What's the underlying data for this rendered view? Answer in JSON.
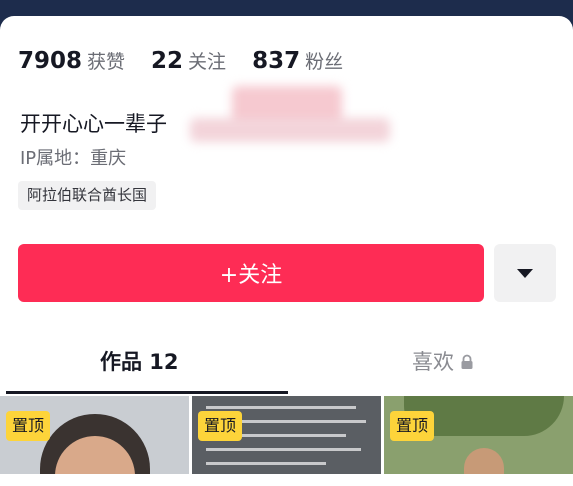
{
  "stats": [
    {
      "num": "7908",
      "label": "获赞"
    },
    {
      "num": "22",
      "label": "关注"
    },
    {
      "num": "837",
      "label": "粉丝"
    }
  ],
  "profile": {
    "name": "开开心心一辈子",
    "ip_location": "IP属地：重庆",
    "region_tag": "阿拉伯联合酋长国"
  },
  "actions": {
    "follow_label": "+关注",
    "more_icon": "caret-down-icon"
  },
  "tabs": [
    {
      "label": "作品 12",
      "active": true
    },
    {
      "label": "喜欢",
      "locked": true,
      "icon": "lock-icon"
    }
  ],
  "videos": [
    {
      "badge": "置顶"
    },
    {
      "badge": "置顶"
    },
    {
      "badge": "置顶"
    }
  ],
  "colors": {
    "accent": "#fe2c55",
    "pin_badge": "#fdd43a",
    "header_bg": "#1d2c4c"
  }
}
